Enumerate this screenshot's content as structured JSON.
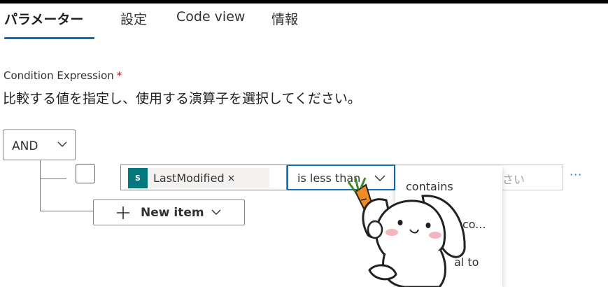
{
  "tabs": [
    {
      "label": "パラメーター",
      "active": true
    },
    {
      "label": "設定",
      "active": false
    },
    {
      "label": "Code view",
      "active": false
    },
    {
      "label": "情報",
      "active": false
    }
  ],
  "condition": {
    "label": "Condition Expression",
    "required_mark": "*",
    "description": "比較する値を指定し、使用する演算子を選択してください。"
  },
  "group": {
    "operator": "AND"
  },
  "row": {
    "token_icon_text": "S",
    "token_label": "LastModified",
    "token_remove": "×",
    "operator": "is less than",
    "right_placeholder": "さい",
    "more": "···"
  },
  "operator_menu": {
    "items": [
      "contains",
      "co...",
      "al to"
    ]
  },
  "new_item": {
    "label": "New item"
  },
  "icons": {
    "and_chevron": "chevron-down-icon",
    "operator_chevron": "chevron-down-icon",
    "plus": "plus-icon",
    "sharepoint": "sharepoint-icon"
  },
  "colors": {
    "accent": "#0f6cbd",
    "tree_line": "#2b88d8",
    "token_icon_bg": "#03787c",
    "required": "#a4262c"
  }
}
